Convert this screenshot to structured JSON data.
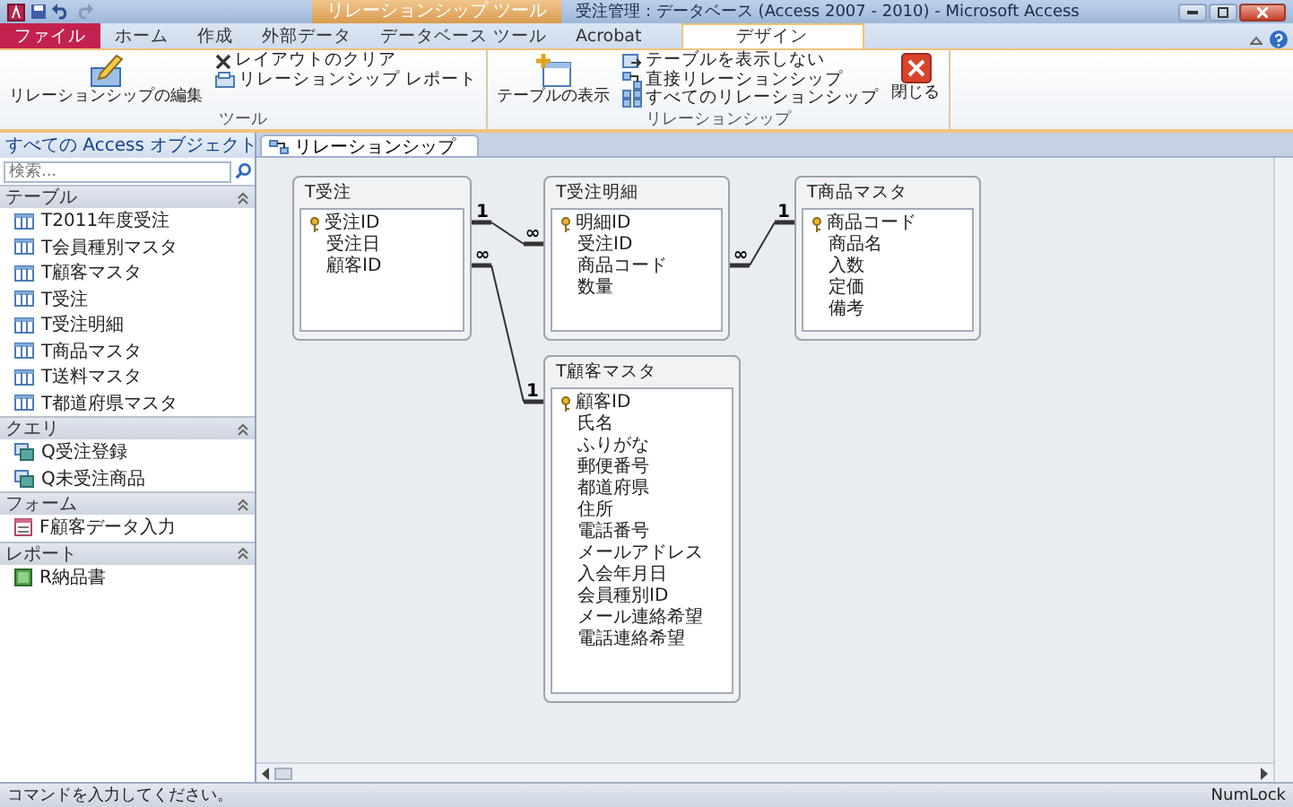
{
  "window": {
    "title": "受注管理 : データベース (Access 2007 - 2010) - Microsoft Access",
    "context_header": "リレーションシップ ツール"
  },
  "tabs": [
    {
      "label": "ファイル",
      "kind": "file",
      "selected": false
    },
    {
      "label": "ホーム",
      "kind": "tab",
      "selected": false
    },
    {
      "label": "作成",
      "kind": "tab",
      "selected": false
    },
    {
      "label": "外部データ",
      "kind": "tab",
      "selected": false
    },
    {
      "label": "データベース ツール",
      "kind": "tab",
      "selected": false
    },
    {
      "label": "Acrobat",
      "kind": "tab",
      "selected": false
    },
    {
      "label": "デザイン",
      "kind": "tab",
      "selected": true
    }
  ],
  "ribbon": [
    {
      "label": "ツール",
      "buttons": [
        {
          "label": "リレーションシップの編集",
          "kind": "large"
        },
        {
          "label": "レイアウトのクリア",
          "kind": "small"
        },
        {
          "label": "リレーションシップ レポート",
          "kind": "small"
        }
      ]
    },
    {
      "label": "リレーションシップ",
      "buttons": [
        {
          "label": "テーブルの表示",
          "kind": "large"
        },
        {
          "label": "テーブルを表示しない",
          "kind": "small"
        },
        {
          "label": "直接リレーションシップ",
          "kind": "small"
        },
        {
          "label": "すべてのリレーションシップ",
          "kind": "small"
        },
        {
          "label": "閉じる",
          "kind": "large"
        }
      ]
    }
  ],
  "nav_pane": {
    "title": "すべての Access オブジェクト",
    "search": {
      "placeholder": "検索..."
    },
    "groups": [
      {
        "label": "テーブル",
        "kind": "table",
        "items": [
          "T2011年度受注",
          "T会員種別マスタ",
          "T顧客マスタ",
          "T受注",
          "T受注明細",
          "T商品マスタ",
          "T送料マスタ",
          "T都道府県マスタ"
        ]
      },
      {
        "label": "クエリ",
        "kind": "query",
        "items": [
          "Q受注登録",
          "Q未受注商品"
        ]
      },
      {
        "label": "フォーム",
        "kind": "form",
        "items": [
          "F顧客データ入力"
        ]
      },
      {
        "label": "レポート",
        "kind": "report",
        "items": [
          "R納品書"
        ]
      }
    ]
  },
  "document_tab": {
    "label": "リレーションシップ"
  },
  "tables": [
    {
      "title": "T受注",
      "fields": [
        "受注ID",
        "受注日",
        "顧客ID"
      ]
    },
    {
      "title": "T受注明細",
      "fields": [
        "明細ID",
        "受注ID",
        "商品コード",
        "数量"
      ]
    },
    {
      "title": "T商品マスタ",
      "fields": [
        "商品コード",
        "商品名",
        "入数",
        "定価",
        "備考"
      ]
    },
    {
      "title": "T顧客マスタ",
      "fields": [
        "顧客ID",
        "氏名",
        "ふりがな",
        "郵便番号",
        "都道府県",
        "住所",
        "電話番号",
        "メールアドレス",
        "入会年月日",
        "会員種別ID",
        "メール連絡希望",
        "電話連絡希望"
      ]
    }
  ],
  "relationships": [
    {
      "left_mark": "1",
      "right_mark": "∞"
    },
    {
      "left_mark": "∞",
      "right_mark": "1"
    },
    {
      "left_mark": "∞",
      "right_mark": "1"
    }
  ],
  "status_bar": {
    "message": "コマンドを入力してください。",
    "indicator": "NumLock"
  }
}
